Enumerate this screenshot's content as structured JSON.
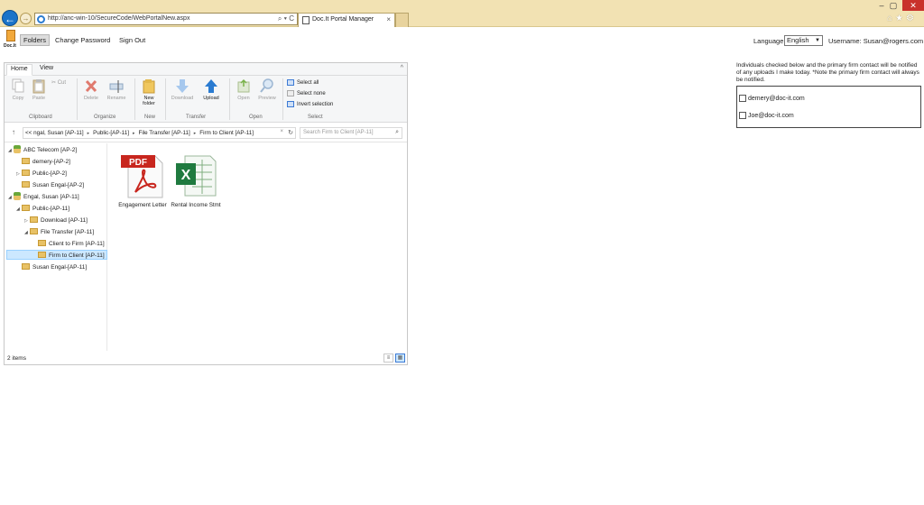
{
  "browser": {
    "url": "http://anc-win-10/SecureCode/WebPortalNew.aspx",
    "tab_title": "Doc.It Portal Manager",
    "tab_close": "×",
    "back": "←",
    "forward": "→",
    "address_controls": "⌕ ▾ C",
    "win_min": "–",
    "win_max": "▢",
    "win_close": "✕",
    "tool_icons": "⌂★⚙"
  },
  "app": {
    "logo_text": "Doc.It",
    "nav": {
      "folders": "Folders",
      "change_password": "Change Password",
      "sign_out": "Sign Out"
    },
    "language_label": "Language:",
    "language_value": "English",
    "username": "Username: Susan@rogers.com"
  },
  "explorer": {
    "tabs": {
      "home": "Home",
      "view": "View"
    },
    "ribbon_collapse": "^",
    "ribbon": {
      "copy": "Copy",
      "paste": "Paste",
      "cut": "Cut",
      "delete": "Delete",
      "rename": "Rename",
      "new_folder": "New folder",
      "download": "Download",
      "upload": "Upload",
      "open": "Open",
      "preview": "Preview",
      "select_all": "Select all",
      "select_none": "Select none",
      "invert_selection": "Invert selection",
      "groups": {
        "clipboard": "Clipboard",
        "organize": "Organize",
        "new": "New",
        "transfer": "Transfer",
        "open": "Open",
        "select": "Select"
      }
    },
    "up_arrow": "↑",
    "breadcrumb": [
      "<< ngal, Susan [AP-11]",
      "Public-[AP-11]",
      "File Transfer [AP-11]",
      "Firm to Client [AP-11]"
    ],
    "breadcrumb_sep": "▸",
    "clear": "×",
    "refresh": "↻",
    "search_placeholder": "Search Firm to Client [AP-11]",
    "search_icon": "⌕",
    "tree": [
      "ABC Telecom [AP-2]",
      "demery-[AP-2]",
      "Public-[AP-2]",
      "Susan Engal-[AP-2]",
      "Engal, Susan [AP-11]",
      "Public-[AP-11]",
      "Download [AP-11]",
      "File Transfer [AP-11]",
      "Client to Firm [AP-11]",
      "Firm to Client [AP-11]",
      "Susan Engal-[AP-11]"
    ],
    "tree_toggles": {
      "expanded": "◢",
      "collapsed": "▷"
    },
    "files": [
      {
        "name": "Engagement Letter",
        "type_label": "PDF"
      },
      {
        "name": "Rental Income Stmt",
        "type_label": "X"
      }
    ],
    "status_count": "2 items",
    "view_details": "≡",
    "view_icons": "▦"
  },
  "notify": {
    "text": "Individuals checked below and the primary firm contact will be notified of any uploads I make today. *Note the primary firm contact will always be notified.",
    "recipients": [
      "demery@doc-it.com",
      "Joe@doc-it.com"
    ]
  }
}
